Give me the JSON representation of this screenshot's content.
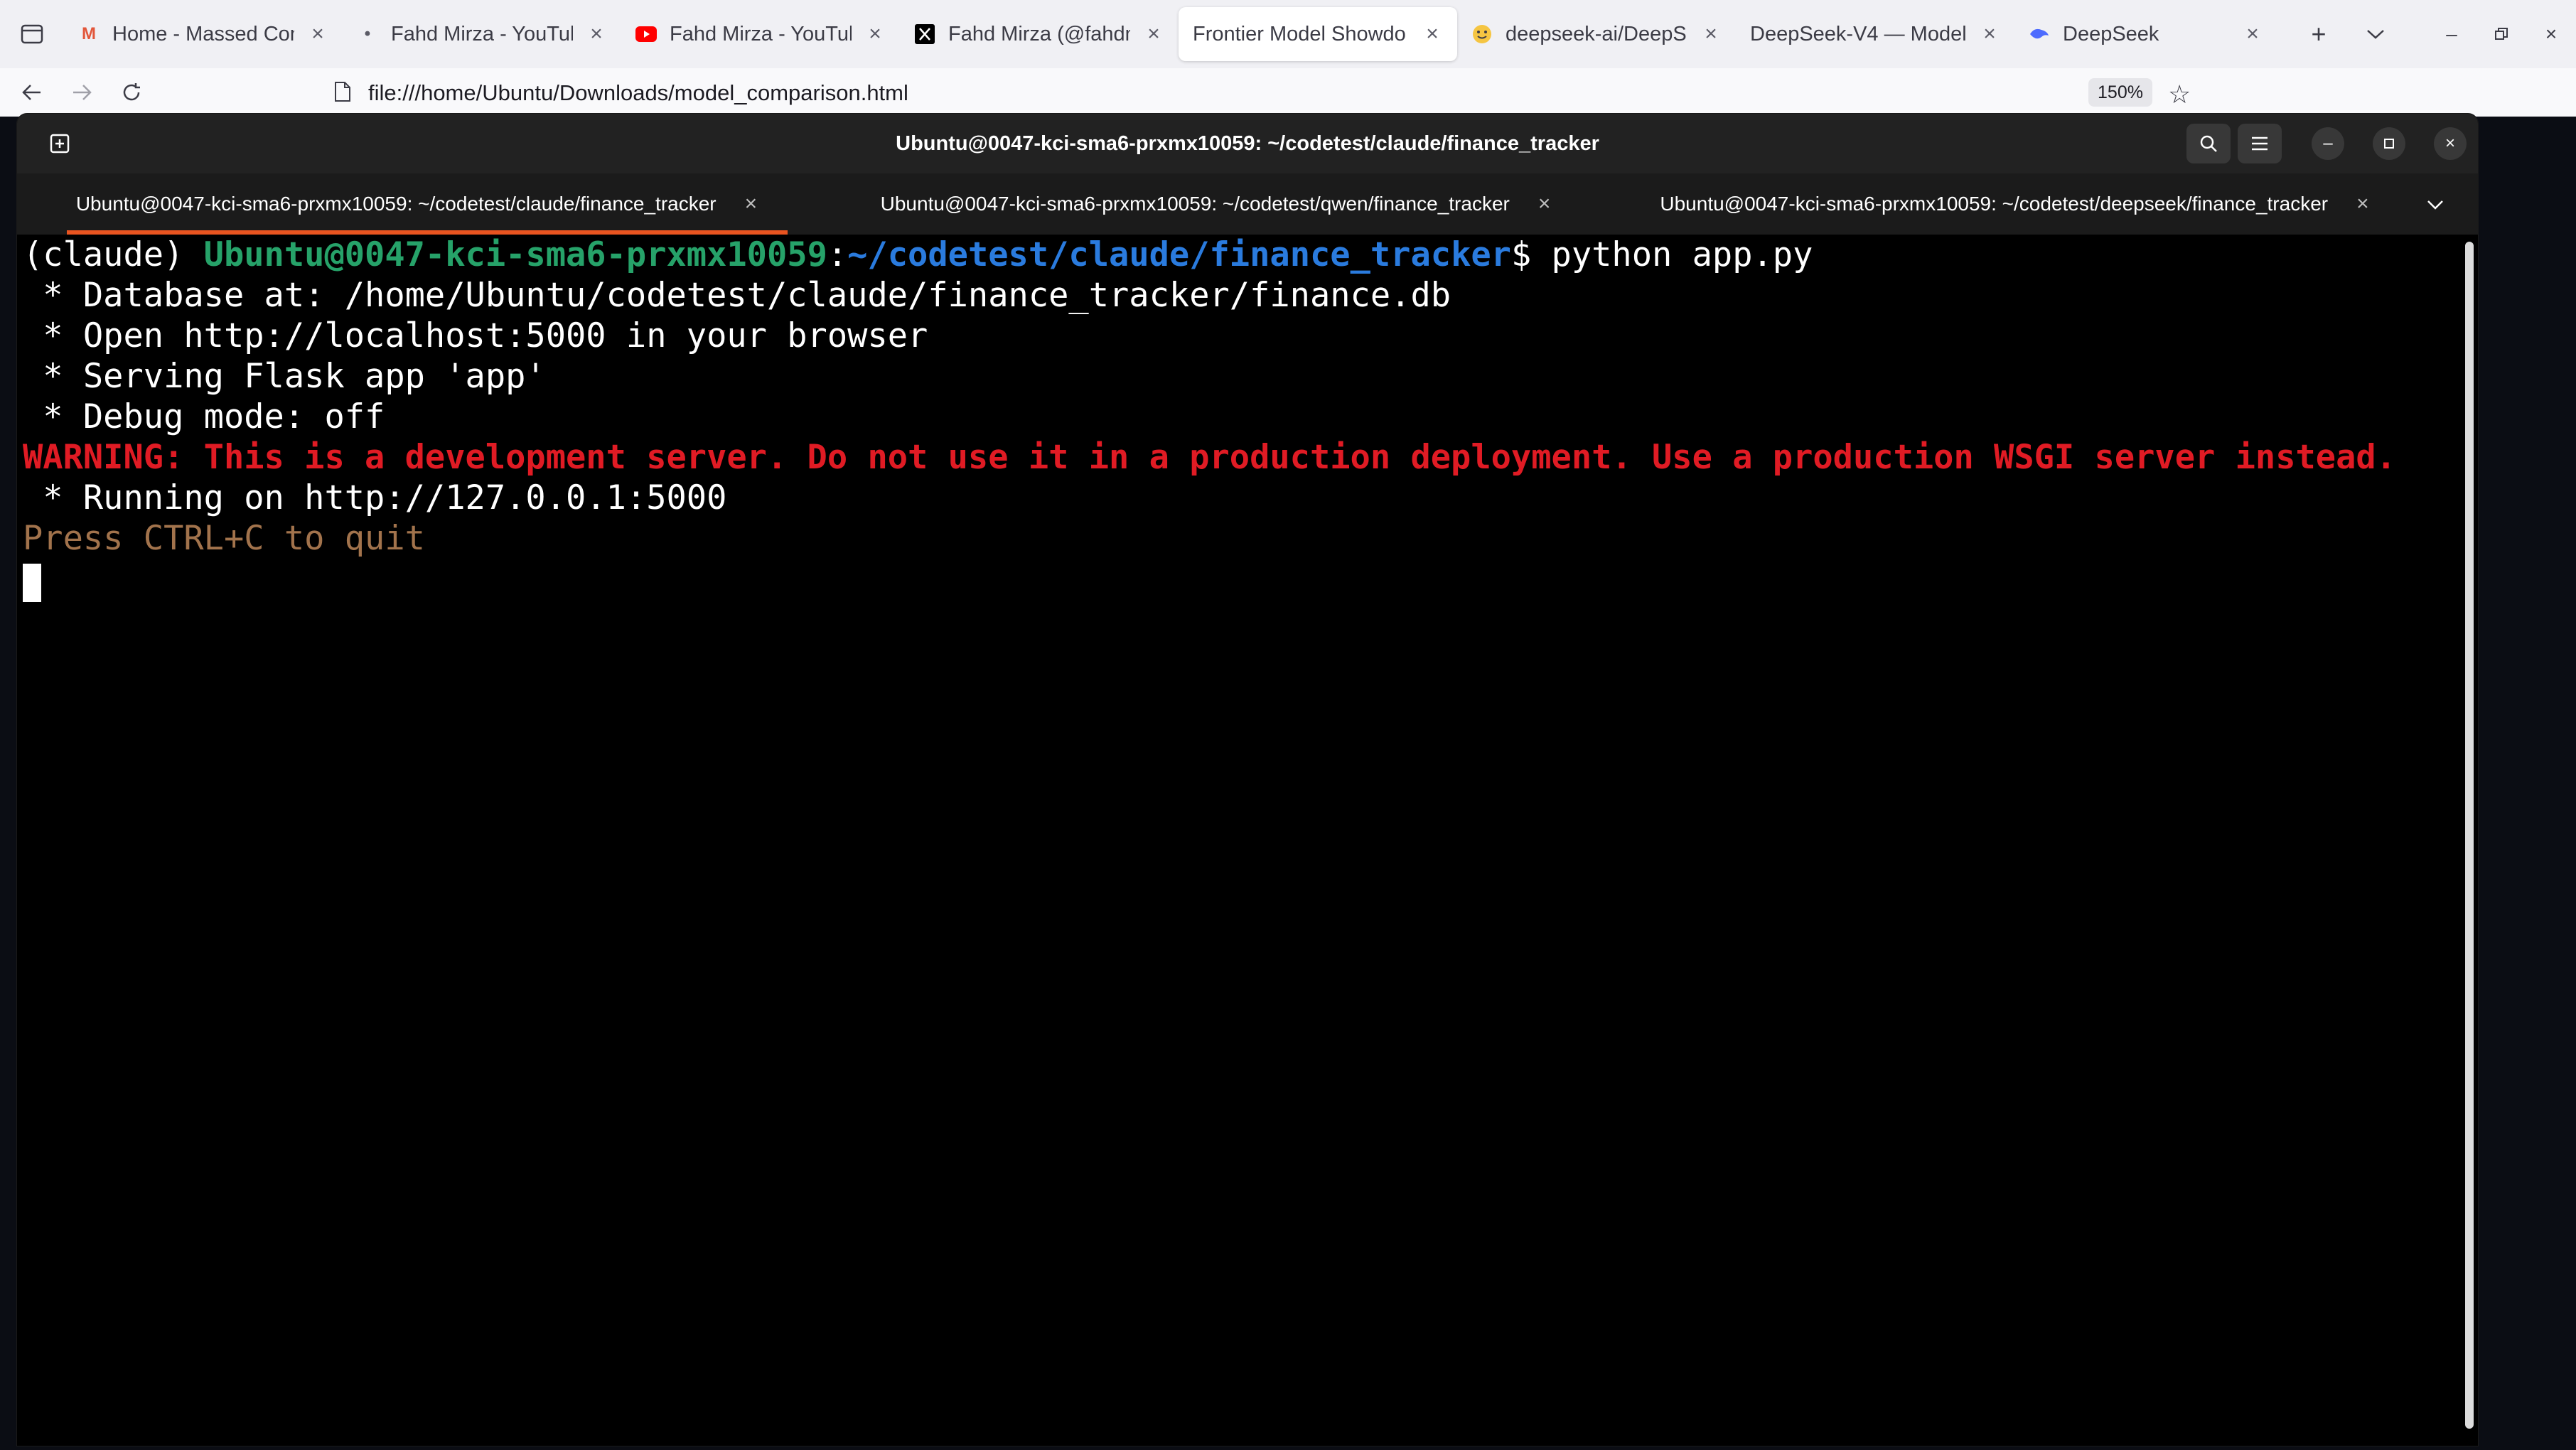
{
  "browser": {
    "tabs": [
      {
        "title": "Home - Massed Comp",
        "icon": "massed-compute-icon",
        "icon_color": "#e2563a",
        "active": false
      },
      {
        "title": "Fahd Mirza - YouTube",
        "icon": "dot-icon",
        "icon_color": "#5b5b66",
        "active": false
      },
      {
        "title": "Fahd Mirza - YouTube",
        "icon": "youtube-icon",
        "icon_color": "#ff0000",
        "active": false
      },
      {
        "title": "Fahd Mirza (@fahdmi",
        "icon": "x-icon",
        "icon_color": "#000000",
        "active": false
      },
      {
        "title": "Frontier Model Showdo",
        "icon": "",
        "icon_color": "",
        "active": true
      },
      {
        "title": "deepseek-ai/DeepSe",
        "icon": "huggingface-icon",
        "icon_color": "#f5c542",
        "active": false
      },
      {
        "title": "DeepSeek-V4 — Model",
        "icon": "",
        "icon_color": "",
        "active": false
      },
      {
        "title": "DeepSeek",
        "icon": "deepseek-whale-icon",
        "icon_color": "#4d6bfe",
        "active": false
      }
    ],
    "url": "file:///home/Ubuntu/Downloads/model_comparison.html",
    "zoom": "150%"
  },
  "terminal": {
    "window_title": "Ubuntu@0047-kci-sma6-prxmx10059: ~/codetest/claude/finance_tracker",
    "tabs": [
      {
        "label": "Ubuntu@0047-kci-sma6-prxmx10059: ~/codetest/claude/finance_tracker",
        "active": true
      },
      {
        "label": "Ubuntu@0047-kci-sma6-prxmx10059: ~/codetest/qwen/finance_tracker",
        "active": false
      },
      {
        "label": "Ubuntu@0047-kci-sma6-prxmx10059: ~/codetest/deepseek/finance_tracker",
        "active": false
      }
    ],
    "prompt": {
      "env": "(claude) ",
      "user": "Ubuntu@0047-kci-sma6-prxmx10059",
      "colon": ":",
      "path": "~/codetest/claude/finance_tracker",
      "symbol": "$ ",
      "command": "python app.py"
    },
    "output": {
      "line1": " * Database at: /home/Ubuntu/codetest/claude/finance_tracker/finance.db",
      "line2": " * Open http://localhost:5000 in your browser",
      "line3": " * Serving Flask app 'app'",
      "line4": " * Debug mode: off",
      "warning": "WARNING: This is a development server. Do not use it in a production deployment. Use a production WSGI server instead.",
      "line5": " * Running on http://127.0.0.1:5000",
      "quit": "Press CTRL+C to quit"
    },
    "colors": {
      "user": "#26a269",
      "path": "#2a7bde",
      "warning": "#e01b24",
      "quit": "#a2734c",
      "active_tab_accent": "#e95420"
    }
  }
}
